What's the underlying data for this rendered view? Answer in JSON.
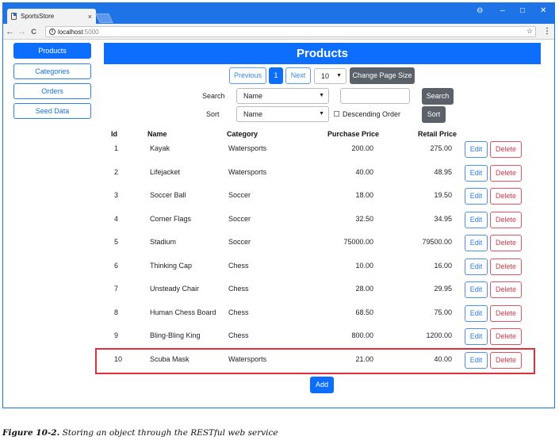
{
  "browser": {
    "tab_title": "SportsStore",
    "tab_close": "×",
    "url_host": "localhost",
    "url_port": ":5000",
    "back": "←",
    "forward": "→",
    "reload": "C",
    "info": "i",
    "star": "☆",
    "menu": "⋮",
    "account": "⊖",
    "minimize": "–",
    "maximize": "□",
    "close": "✕"
  },
  "sidebar": {
    "items": [
      {
        "label": "Products",
        "active": true
      },
      {
        "label": "Categories",
        "active": false
      },
      {
        "label": "Orders",
        "active": false
      },
      {
        "label": "Seed Data",
        "active": false
      }
    ]
  },
  "header": {
    "title": "Products"
  },
  "pagination": {
    "previous": "Previous",
    "current_page": "1",
    "next": "Next",
    "page_size": "10",
    "change_size": "Change Page Size"
  },
  "search": {
    "label": "Search",
    "field": "Name",
    "button": "Search"
  },
  "sort": {
    "label": "Sort",
    "field": "Name",
    "descending_label": "Descending Order",
    "button": "Sort"
  },
  "table": {
    "headers": [
      "Id",
      "Name",
      "Category",
      "Purchase Price",
      "Retail Price"
    ],
    "edit_label": "Edit",
    "delete_label": "Delete",
    "rows": [
      {
        "id": "1",
        "name": "Kayak",
        "category": "Watersports",
        "purchase": "200.00",
        "retail": "275.00"
      },
      {
        "id": "2",
        "name": "Lifejacket",
        "category": "Watersports",
        "purchase": "40.00",
        "retail": "48.95"
      },
      {
        "id": "3",
        "name": "Soccer Ball",
        "category": "Soccer",
        "purchase": "18.00",
        "retail": "19.50"
      },
      {
        "id": "4",
        "name": "Corner Flags",
        "category": "Soccer",
        "purchase": "32.50",
        "retail": "34.95"
      },
      {
        "id": "5",
        "name": "Stadium",
        "category": "Soccer",
        "purchase": "75000.00",
        "retail": "79500.00"
      },
      {
        "id": "6",
        "name": "Thinking Cap",
        "category": "Chess",
        "purchase": "10.00",
        "retail": "16.00"
      },
      {
        "id": "7",
        "name": "Unsteady Chair",
        "category": "Chess",
        "purchase": "28.00",
        "retail": "29.95"
      },
      {
        "id": "8",
        "name": "Human Chess Board",
        "category": "Chess",
        "purchase": "68.50",
        "retail": "75.00"
      },
      {
        "id": "9",
        "name": "Bling-Bling King",
        "category": "Chess",
        "purchase": "800.00",
        "retail": "1200.00"
      },
      {
        "id": "10",
        "name": "Scuba Mask",
        "category": "Watersports",
        "purchase": "21.00",
        "retail": "40.00"
      }
    ]
  },
  "add_button": "Add",
  "caption": {
    "figure": "Figure 10-2.",
    "text": "Storing an object through the RESTful web service"
  },
  "colors": {
    "primary": "#0d6efd",
    "danger": "#d9394a",
    "highlight": "#e32f3a",
    "chrome": "#1e74e6"
  }
}
